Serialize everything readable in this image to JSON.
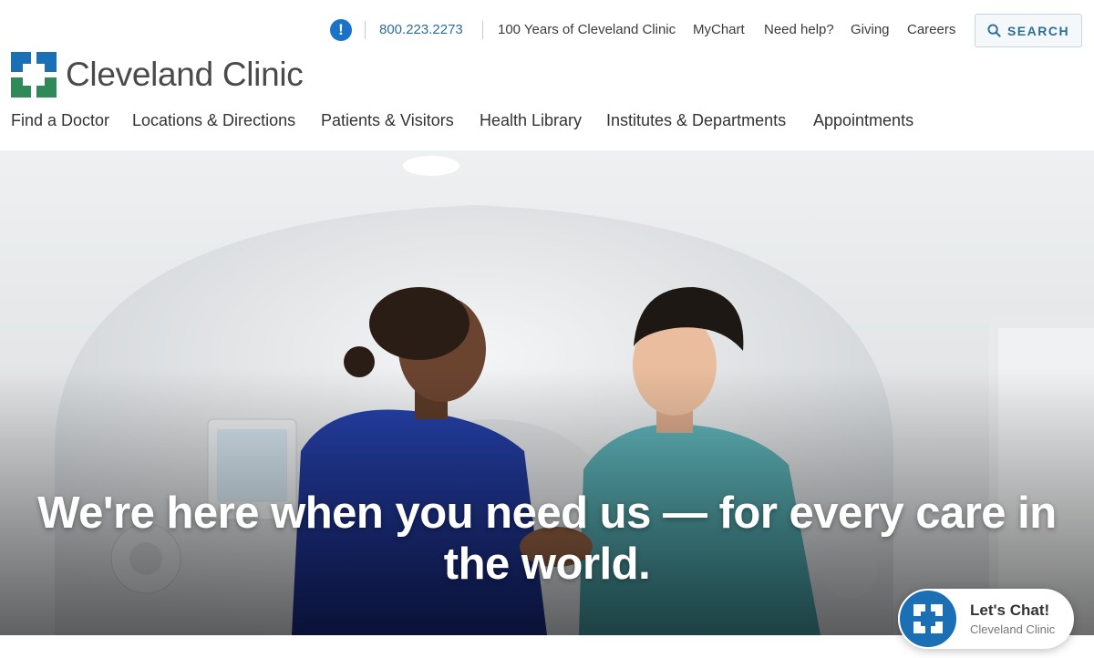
{
  "utility": {
    "phone": "800.223.2273",
    "links": [
      "100 Years of Cleveland Clinic",
      "MyChart",
      "Need help?",
      "Giving",
      "Careers"
    ],
    "alert_symbol": "!",
    "search_label": "SEARCH"
  },
  "logo": {
    "text": "Cleveland Clinic"
  },
  "nav": {
    "items": [
      "Find a Doctor",
      "Locations & Directions",
      "Patients & Visitors",
      "Health Library",
      "Institutes & Departments",
      "Appointments"
    ]
  },
  "hero": {
    "headline_line1": "We're here when you need us — for every care in",
    "headline_line2": "the world."
  },
  "chat": {
    "title": "Let's Chat!",
    "subtitle": "Cleveland Clinic"
  },
  "colors": {
    "brand_blue": "#1a6fb5",
    "brand_green": "#2e8b57",
    "link_blue": "#2c6e9b"
  },
  "icons": [
    "alert-icon",
    "search-icon",
    "logo-cross-icon",
    "chat-cross-icon"
  ]
}
